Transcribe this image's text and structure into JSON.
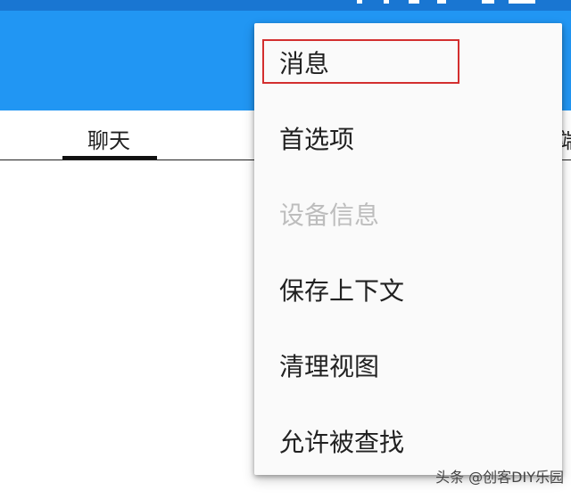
{
  "colors": {
    "status_bar": "#1976d2",
    "app_bar": "#2196f3",
    "menu_background": "#fafafa",
    "highlight": "#d32f2f",
    "disabled_text": "#bdbdbd"
  },
  "tabs": [
    {
      "label": "聊天",
      "selected": true
    },
    {
      "label": "端",
      "selected": false,
      "partially_visible": true
    }
  ],
  "overflow_menu": {
    "items": [
      {
        "label": "消息",
        "enabled": true,
        "highlighted": true
      },
      {
        "label": "首选项",
        "enabled": true
      },
      {
        "label": "设备信息",
        "enabled": false
      },
      {
        "label": "保存上下文",
        "enabled": true
      },
      {
        "label": "清理视图",
        "enabled": true
      },
      {
        "label": "允许被查找",
        "enabled": true
      }
    ]
  },
  "watermark": "头条 @创客DIY乐园"
}
